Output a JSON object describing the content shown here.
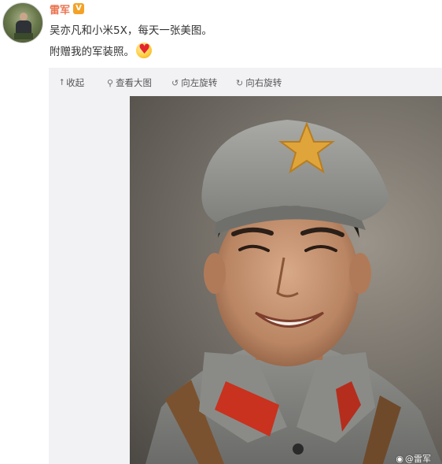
{
  "post": {
    "author_name": "雷军",
    "verified_badge": "V",
    "text_line1": "吴亦凡和小米5X，每天一张美图。",
    "text_line2": "附赠我的军装照。",
    "emoji": "love-emoji"
  },
  "media_toolbar": {
    "collapse_label": "收起",
    "collapse_icon": "arrow-up-icon",
    "view_large_label": "查看大图",
    "view_large_icon": "magnifier-icon",
    "rotate_left_label": "向左旋转",
    "rotate_left_icon": "rotate-left-icon",
    "rotate_right_label": "向右旋转",
    "rotate_right_icon": "rotate-right-icon"
  },
  "watermark": {
    "text": "@雷军",
    "icon": "weibo-icon"
  },
  "colors": {
    "author": "#eb7350",
    "badge": "#f4a227",
    "media_bg": "#f2f2f5"
  }
}
